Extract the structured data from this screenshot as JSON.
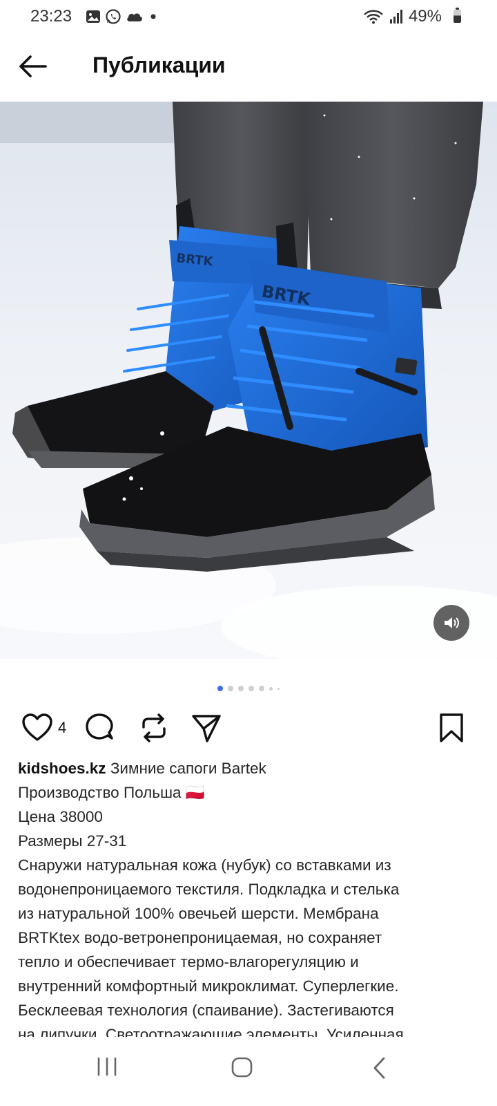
{
  "status_bar": {
    "time": "23:23",
    "battery": "49%",
    "left_icons": [
      "gallery-icon",
      "whatsapp-icon",
      "cloud-icon",
      "dot-icon"
    ],
    "right_icons": [
      "wifi-icon",
      "signal-icon",
      "battery-icon"
    ]
  },
  "header": {
    "title": "Публикации",
    "back_icon": "arrow-left-icon"
  },
  "media": {
    "sound_icon": "speaker-icon",
    "carousel_total_dots": 7,
    "carousel_active_index": 0
  },
  "actions": {
    "like_count": "4",
    "icons": [
      "heart-icon",
      "comment-icon",
      "repost-icon",
      "send-icon",
      "bookmark-icon"
    ]
  },
  "caption": {
    "username": "kidshoes.kz",
    "first_line_text": " Зимние сапоги Bartek",
    "line2": "Производство Польша 🇵🇱",
    "line3": "Цена 38000",
    "line4": "Размеры 27-31",
    "line5": "Снаружи натуральная кожа (нубук) со вставками из",
    "line6": "водонепроницаемого текстиля. Подкладка и стелька",
    "line7": "из натуральной 100% овечьей шерсти. Мембрана",
    "line8": "BRTKtex водо-ветронепроницаемая, но сохраняет",
    "line9": "тепло и обеспечивает термо-влагорегуляцию и",
    "line10": "внутренний комфортный микроклимат. Суперлегкие.",
    "line11": "Бесклеевая технология (спаивание). Застегиваются",
    "line12": "на липучки. Светоотражающие элементы. Усиленная"
  },
  "nav_bar": {
    "icons": [
      "recent-apps-icon",
      "home-icon",
      "back-icon"
    ]
  },
  "colors": {
    "accent_dot": "#3b6fe0",
    "boot_blue": "#1f6fd6",
    "text": "#262626"
  }
}
